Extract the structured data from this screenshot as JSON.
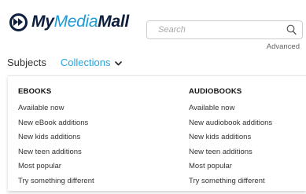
{
  "brand": {
    "part_my": "My",
    "part_media": "Media",
    "part_mall": "Mall"
  },
  "search": {
    "placeholder": "Search",
    "value": "",
    "advanced_label": "Advanced"
  },
  "nav": {
    "subjects_label": "Subjects",
    "collections_label": "Collections"
  },
  "colors": {
    "brand_dark": "#0d1f3c",
    "brand_blue": "#1b9cd6",
    "link_blue": "#2aa3d9"
  },
  "icons": {
    "logo": "fast-forward-circle-icon",
    "search": "search-icon",
    "collections_toggle": "chevron-down-icon"
  },
  "menu": {
    "ebooks": {
      "heading": "EBOOKS",
      "items": [
        "Available now",
        "New eBook additions",
        "New kids additions",
        "New teen additions",
        "Most popular",
        "Try something different"
      ]
    },
    "audiobooks": {
      "heading": "AUDIOBOOKS",
      "items": [
        "Available now",
        "New audiobook additions",
        "New kids additions",
        "New teen additions",
        "Most popular",
        "Try something different"
      ]
    }
  }
}
